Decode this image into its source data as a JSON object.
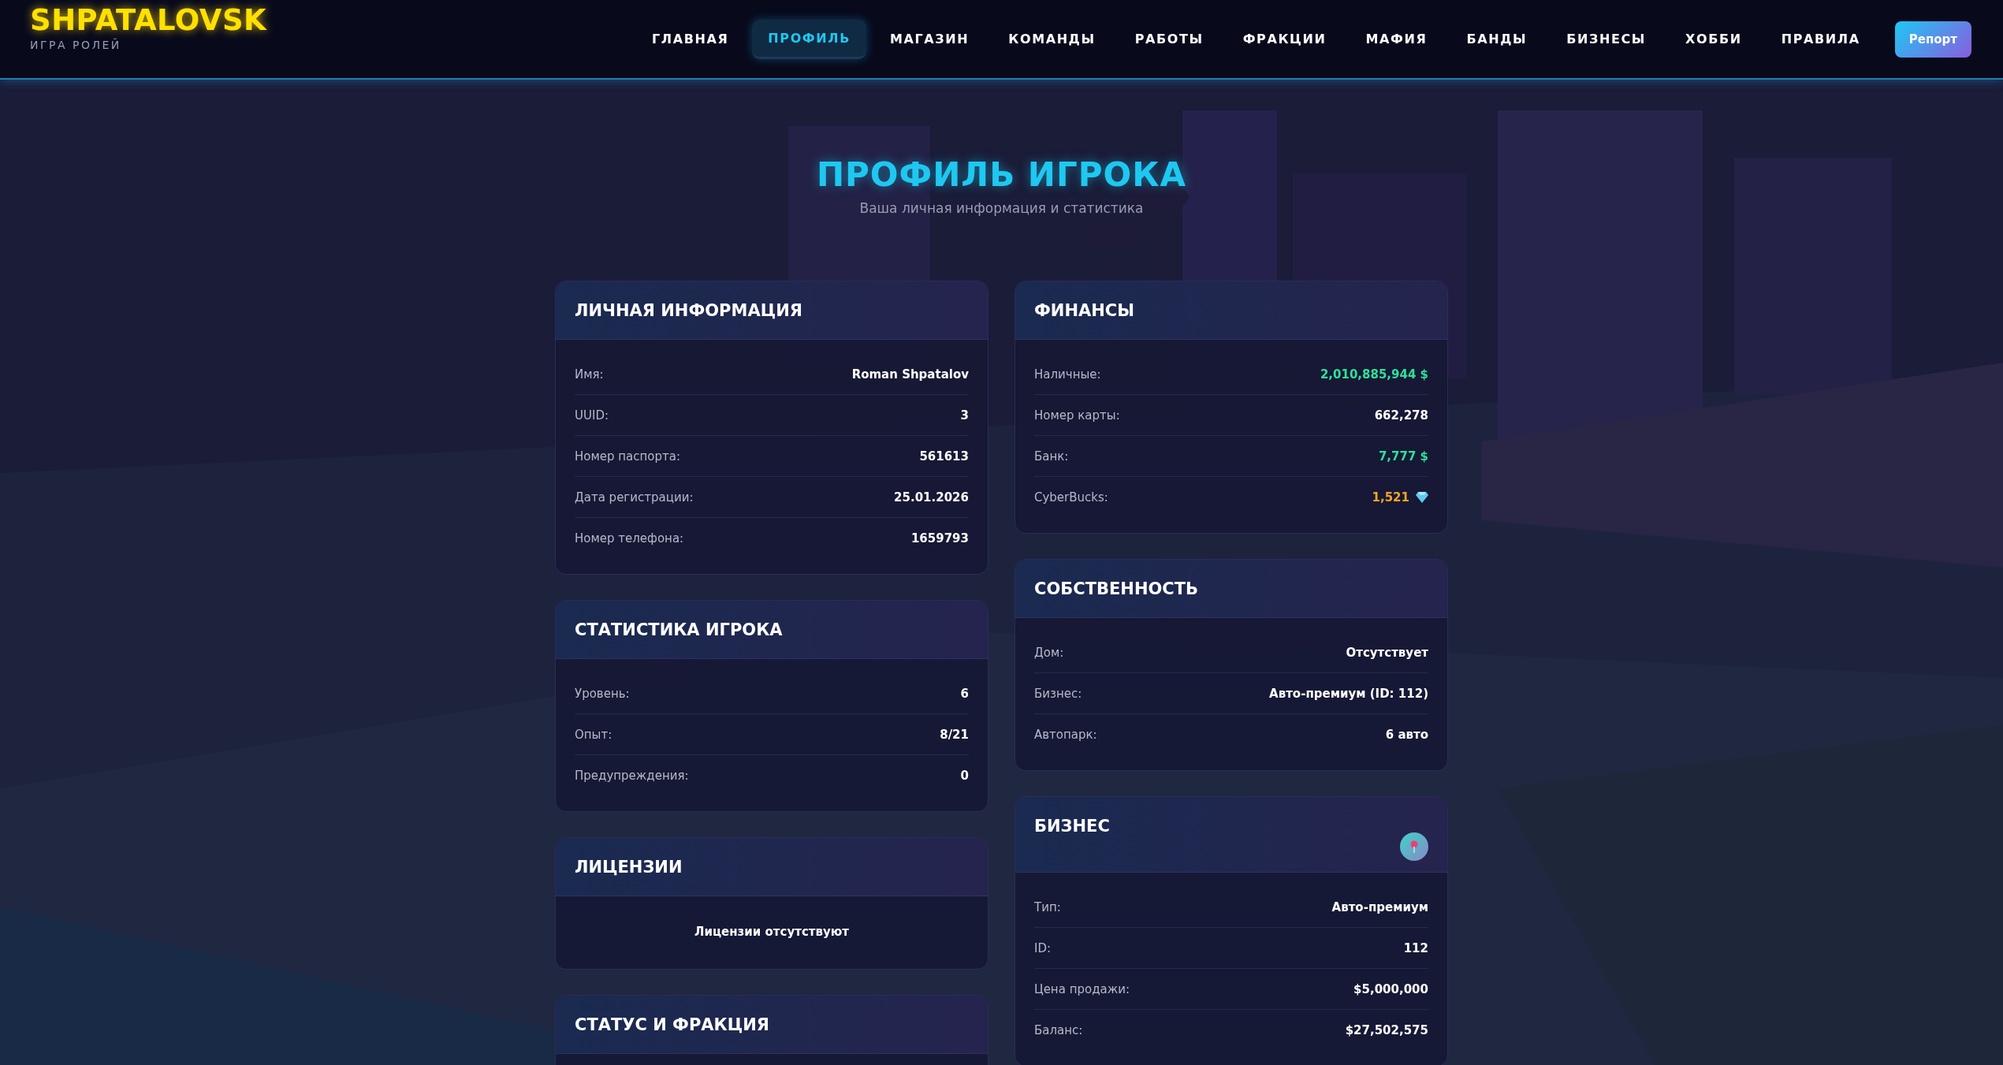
{
  "logo": {
    "title": "SHPATALOVSK",
    "subtitle": "ИГРА РОЛЕЙ"
  },
  "nav": [
    {
      "label": "ГЛАВНАЯ",
      "selected": false
    },
    {
      "label": "ПРОФИЛЬ",
      "selected": true
    },
    {
      "label": "МАГАЗИН",
      "selected": false
    },
    {
      "label": "КОМАНДЫ",
      "selected": false
    },
    {
      "label": "РАБОТЫ",
      "selected": false
    },
    {
      "label": "ФРАКЦИИ",
      "selected": false
    },
    {
      "label": "МАФИЯ",
      "selected": false
    },
    {
      "label": "БАНДЫ",
      "selected": false
    },
    {
      "label": "БИЗНЕСЫ",
      "selected": false
    },
    {
      "label": "ХОББИ",
      "selected": false
    },
    {
      "label": "ПРАВИЛА",
      "selected": false
    }
  ],
  "report_button": "Репорт",
  "page_title": "ПРОФИЛЬ ИГРОКА",
  "page_subtitle": "Ваша личная информация и статистика",
  "left_column": [
    {
      "title": "ЛИЧНАЯ ИНФОРМАЦИЯ",
      "rows": [
        {
          "label": "Имя:",
          "value": "Roman Shpatalov",
          "kind": "plain"
        },
        {
          "label": "UUID:",
          "value": "3",
          "kind": "plain"
        },
        {
          "label": "Номер паспорта:",
          "value": "561613",
          "kind": "plain"
        },
        {
          "label": "Дата регистрации:",
          "value": "25.01.2026",
          "kind": "plain"
        },
        {
          "label": "Номер телефона:",
          "value": "1659793",
          "kind": "plain"
        }
      ]
    },
    {
      "title": "СТАТИСТИКА ИГРОКА",
      "rows": [
        {
          "label": "Уровень:",
          "value": "6",
          "kind": "plain"
        },
        {
          "label": "Опыт:",
          "value": "8/21",
          "kind": "plain"
        },
        {
          "label": "Предупреждения:",
          "value": "0",
          "kind": "plain"
        }
      ]
    },
    {
      "title": "ЛИЦЕНЗИИ",
      "empty_text": "Лицензии отсутствуют"
    },
    {
      "title": "СТАТУС И ФРАКЦИЯ"
    }
  ],
  "right_column": [
    {
      "title": "ФИНАНСЫ",
      "rows": [
        {
          "label": "Наличные:",
          "value": "2,010,885,944 $",
          "kind": "money"
        },
        {
          "label": "Номер карты:",
          "value": "662,278",
          "kind": "plain"
        },
        {
          "label": "Банк:",
          "value": "7,777 $",
          "kind": "money"
        },
        {
          "label": "CyberBucks:",
          "value": "1,521",
          "kind": "crypto"
        }
      ]
    },
    {
      "title": "СОБСТВЕННОСТЬ",
      "rows": [
        {
          "label": "Дом:",
          "value": "Отсутствует",
          "kind": "plain"
        },
        {
          "label": "Бизнес:",
          "value": "Авто-премиум (ID: 112)",
          "kind": "plain"
        },
        {
          "label": "Автопарк:",
          "value": "6 авто",
          "kind": "plain"
        }
      ]
    },
    {
      "title": "БИЗНЕС",
      "location_button": true,
      "rows": [
        {
          "label": "Тип:",
          "value": "Авто-премиум",
          "kind": "plain"
        },
        {
          "label": "ID:",
          "value": "112",
          "kind": "plain"
        },
        {
          "label": "Цена продажи:",
          "value": "$5,000,000",
          "kind": "plain"
        },
        {
          "label": "Баланс:",
          "value": "$27,502,575",
          "kind": "plain"
        }
      ]
    }
  ]
}
